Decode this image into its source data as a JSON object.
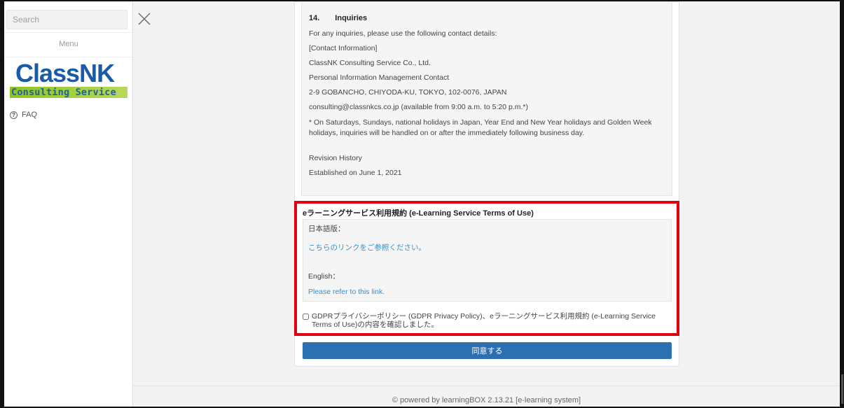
{
  "sidebar": {
    "search_placeholder": "Search",
    "menu_label": "Menu",
    "logo_main": "ClassNK",
    "logo_sub": "Consulting Service",
    "faq_label": "FAQ"
  },
  "policy": {
    "section_number": "14.",
    "section_title": "Inquiries",
    "lines": [
      "For any inquiries, please use the following contact details:",
      "[Contact Information]",
      "ClassNK Consulting Service Co., Ltd.",
      "Personal Information Management Contact",
      "2-9 GOBANCHO, CHIYODA-KU, TOKYO, 102-0076, JAPAN",
      "consulting@classnkcs.co.jp (available from 9:00 a.m. to 5:20 p.m.*)"
    ],
    "note": "* On Saturdays, Sundays, national holidays in Japan, Year End and New Year holidays and Golden Week holidays, inquiries will be handled on or after the immediately following business day.",
    "revision_label": "Revision History",
    "established": "Established on June 1, 2021"
  },
  "terms": {
    "title": "eラーニングサービス利用規約 (e-Learning Service Terms of Use)",
    "japanese_label": "日本語版：",
    "japanese_link": "こちらのリンクをご参照ください。",
    "english_label": "English：",
    "english_link": "Please refer to this link."
  },
  "consent": {
    "text": "GDPRプライバシーポリシー (GDPR Privacy Policy)、eラーニングサービス利用規約 (e-Learning Service Terms of Use)の内容を確認しました。",
    "checked": false
  },
  "agree_button": "同意する",
  "footer": "© powered by learningBOX 2.13.21 [e-learning system]",
  "colors": {
    "accent": "#2c70b1",
    "link": "#3b8ec6",
    "highlight": "#e3000f",
    "logo_blue": "#1b5aa5",
    "logo_green": "#8fc41f"
  }
}
